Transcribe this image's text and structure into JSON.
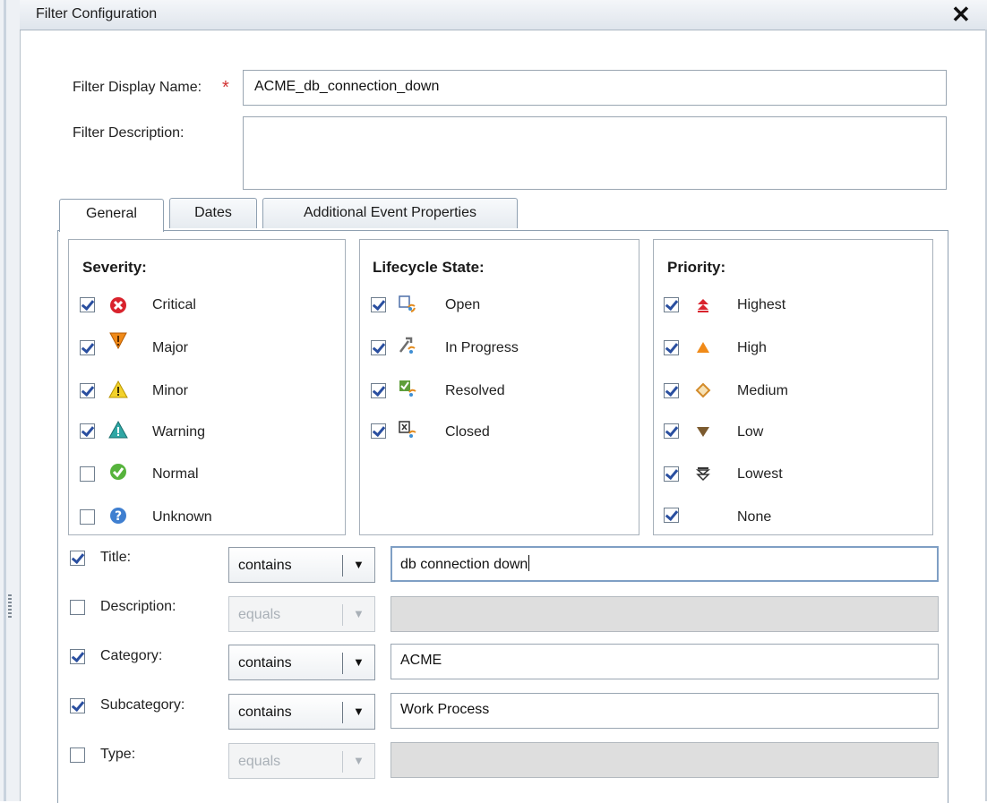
{
  "window": {
    "title": "Filter Configuration"
  },
  "form": {
    "display_name_label": "Filter Display Name:",
    "display_name_value": "ACME_db_connection_down",
    "required_mark": "*",
    "description_label": "Filter Description:",
    "description_value": ""
  },
  "tabs": [
    {
      "label": "General",
      "active": true
    },
    {
      "label": "Dates",
      "active": false
    },
    {
      "label": "Additional Event Properties",
      "active": false
    }
  ],
  "severity": {
    "title": "Severity:",
    "items": [
      {
        "label": "Critical",
        "checked": true,
        "icon": "critical-icon"
      },
      {
        "label": "Major",
        "checked": true,
        "icon": "major-icon"
      },
      {
        "label": "Minor",
        "checked": true,
        "icon": "minor-icon"
      },
      {
        "label": "Warning",
        "checked": true,
        "icon": "warning-icon"
      },
      {
        "label": "Normal",
        "checked": false,
        "icon": "normal-icon"
      },
      {
        "label": "Unknown",
        "checked": false,
        "icon": "unknown-icon"
      }
    ]
  },
  "lifecycle": {
    "title": "Lifecycle State:",
    "items": [
      {
        "label": "Open",
        "checked": true,
        "icon": "open-state-icon"
      },
      {
        "label": "In Progress",
        "checked": true,
        "icon": "in-progress-icon"
      },
      {
        "label": "Resolved",
        "checked": true,
        "icon": "resolved-icon"
      },
      {
        "label": "Closed",
        "checked": true,
        "icon": "closed-icon"
      }
    ]
  },
  "priority": {
    "title": "Priority:",
    "items": [
      {
        "label": "Highest",
        "checked": true,
        "icon": "highest-priority-icon"
      },
      {
        "label": "High",
        "checked": true,
        "icon": "high-priority-icon"
      },
      {
        "label": "Medium",
        "checked": true,
        "icon": "medium-priority-icon"
      },
      {
        "label": "Low",
        "checked": true,
        "icon": "low-priority-icon"
      },
      {
        "label": "Lowest",
        "checked": true,
        "icon": "lowest-priority-icon"
      },
      {
        "label": "None",
        "checked": true,
        "icon": ""
      }
    ]
  },
  "criteria": [
    {
      "label": "Title:",
      "checked": true,
      "operator": "contains",
      "value": "db connection down",
      "enabled": true
    },
    {
      "label": "Description:",
      "checked": false,
      "operator": "equals",
      "value": "",
      "enabled": false
    },
    {
      "label": "Category:",
      "checked": true,
      "operator": "contains",
      "value": "ACME",
      "enabled": true
    },
    {
      "label": "Subcategory:",
      "checked": true,
      "operator": "contains",
      "value": "Work Process",
      "enabled": true
    },
    {
      "label": "Type:",
      "checked": false,
      "operator": "equals",
      "value": "",
      "enabled": false
    }
  ],
  "colors": {
    "required": "#d23333",
    "check": "#2a4fa0",
    "border": "#8fa0b1"
  }
}
